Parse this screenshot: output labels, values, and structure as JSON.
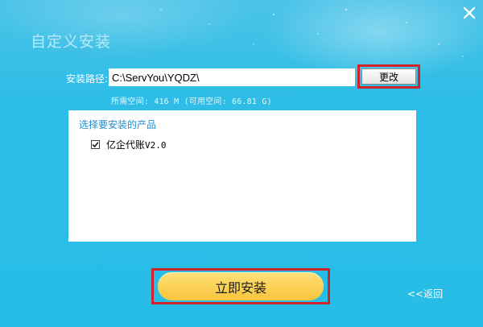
{
  "window": {
    "title": "自定义安装",
    "close_icon": "close-icon"
  },
  "install_path": {
    "label": "安装路径:",
    "value": "C:\\ServYou\\YQDZ\\",
    "change_button": "更改",
    "space_info": "所需空间: 416 M (可用空间: 66.81 G)"
  },
  "products": {
    "title": "选择要安装的产品",
    "items": [
      {
        "name": "亿企代账",
        "version": "V2.0",
        "checked": true
      }
    ]
  },
  "actions": {
    "install_button": "立即安装",
    "back_link": "<<返回"
  },
  "colors": {
    "background": "#2dbde6",
    "install_button": "#fbd156",
    "highlight": "#d2232a",
    "product_title": "#1e8fd0"
  }
}
